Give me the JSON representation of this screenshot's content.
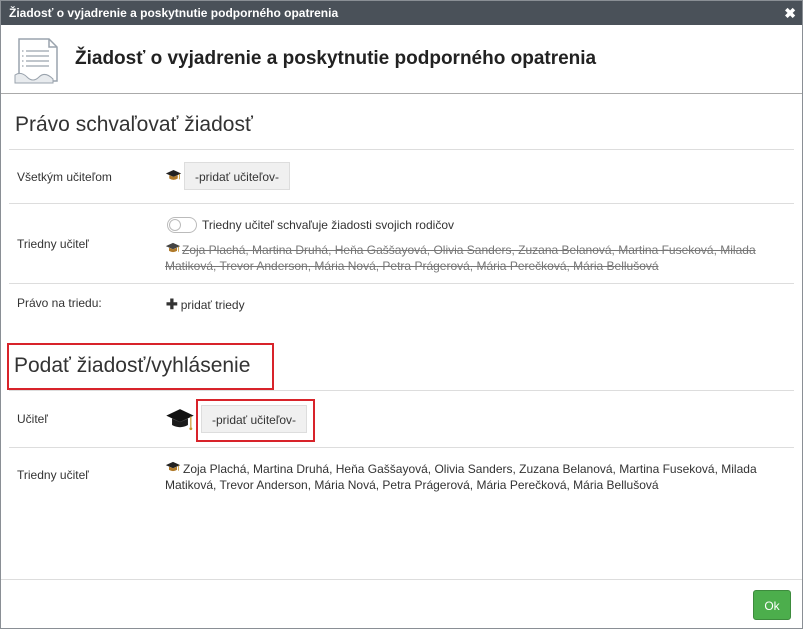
{
  "window": {
    "title": "Žiadosť o vyjadrenie a poskytnutie podporného opatrenia",
    "close_glyph": "✖"
  },
  "header": {
    "title": "Žiadosť o vyjadrenie a poskytnutie podporného opatrenia",
    "icon": "document-icon"
  },
  "approval_section": {
    "title": "Právo schvaľovať žiadosť",
    "all_teachers": {
      "label": "Všetkým učiteľom",
      "add_button": "-pridať učiteľov-"
    },
    "class_teacher": {
      "label": "Triedny učiteľ",
      "toggle_label": "Triedny učiteľ schvaľuje žiadosti svojich rodičov",
      "toggle_on": false,
      "teachers_line1": "Zoja Plachá, Martina Druhá, Heňa Gaššayová, Olivia Sanders, Zuzana Belanová, Martina Fuseková, Milada",
      "teachers_line2": "Matiková, Trevor Anderson, Mária Nová, Petra Prágerová, Mária Perečková, Mária Bellušová"
    },
    "class_right": {
      "label": "Právo na triedu:",
      "add_label": "pridať triedy",
      "add_glyph": "✚"
    }
  },
  "submit_section": {
    "title": "Podať žiadosť/vyhlásenie",
    "teacher": {
      "label": "Učiteľ",
      "add_button": "-pridať učiteľov-"
    },
    "class_teacher": {
      "label": "Triedny učiteľ",
      "teachers_line1": "Zoja Plachá, Martina Druhá, Heňa Gaššayová, Olivia Sanders, Zuzana Belanová, Martina Fuseková, Milada",
      "teachers_line2": "Matiková, Trevor Anderson, Mária Nová, Petra Prágerová, Mária Perečková, Mária Bellušová"
    }
  },
  "footer": {
    "ok_label": "Ok"
  },
  "colors": {
    "titlebar": "#4a5159",
    "highlight": "#d8232a",
    "ok_button": "#4cae4c"
  }
}
